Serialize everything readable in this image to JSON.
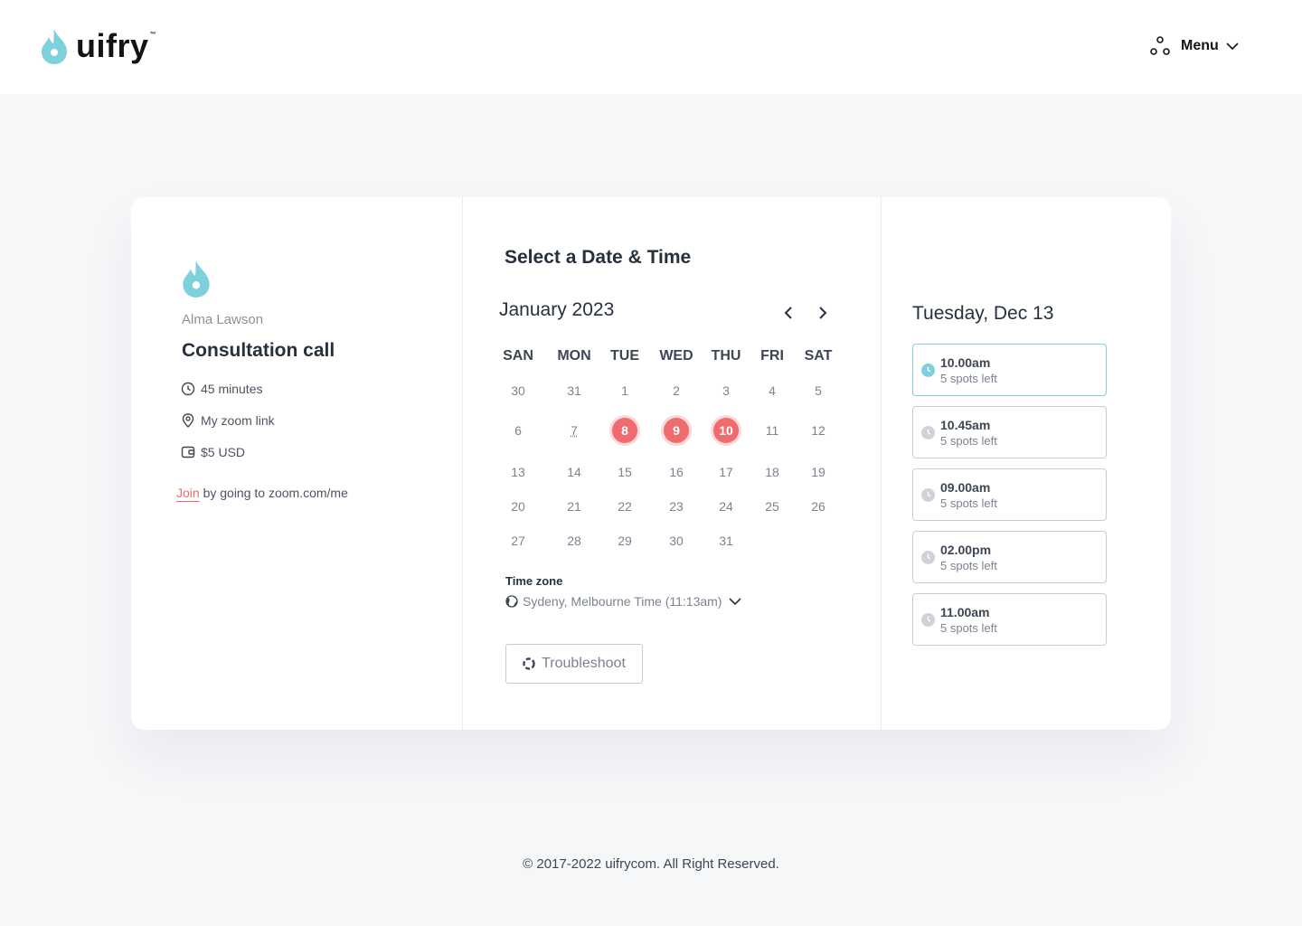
{
  "header": {
    "logo_text": "uifry",
    "logo_tm": "™",
    "menu_label": "Menu",
    "brand_color": "#7fd0dd"
  },
  "event": {
    "host_name": "Alma Lawson",
    "title": "Consultation call",
    "duration": "45 minutes",
    "location": "My zoom link",
    "price": "$5 USD",
    "join_link_label": "Join",
    "join_text": "by going to zoom.com/me"
  },
  "calendar": {
    "heading": "Select a Date & Time",
    "month_label": "January 2023",
    "weekdays": [
      "SAN",
      "MON",
      "TUE",
      "WED",
      "THU",
      "FRI",
      "SAT"
    ],
    "weeks": [
      [
        "30",
        "31",
        "1",
        "2",
        "3",
        "4",
        "5"
      ],
      [
        "6",
        "7",
        "8",
        "9",
        "10",
        "11",
        "12"
      ],
      [
        "13",
        "14",
        "15",
        "16",
        "17",
        "18",
        "19"
      ],
      [
        "20",
        "21",
        "22",
        "23",
        "24",
        "25",
        "26"
      ],
      [
        "27",
        "28",
        "29",
        "30",
        "31",
        "",
        ""
      ]
    ],
    "available_days": [
      "8",
      "9",
      "10"
    ],
    "today_day": "7",
    "available_color": "#ee6b6e",
    "timezone_label": "Time zone",
    "timezone_value": "Sydeny, Melbourne Time (11:13am)",
    "troubleshoot_label": "Troubleshoot"
  },
  "slots": {
    "day_heading": "Tuesday, Dec 13",
    "items": [
      {
        "time": "10.00am",
        "spots": "5 spots left",
        "selected": true
      },
      {
        "time": "10.45am",
        "spots": "5 spots left",
        "selected": false
      },
      {
        "time": "09.00am",
        "spots": "5 spots left",
        "selected": false
      },
      {
        "time": "02.00pm",
        "spots": "5 spots left",
        "selected": false
      },
      {
        "time": "11.00am",
        "spots": "5 spots left",
        "selected": false
      }
    ]
  },
  "footer": {
    "copyright": "© 2017-2022  uifrycom. All Right Reserved."
  }
}
